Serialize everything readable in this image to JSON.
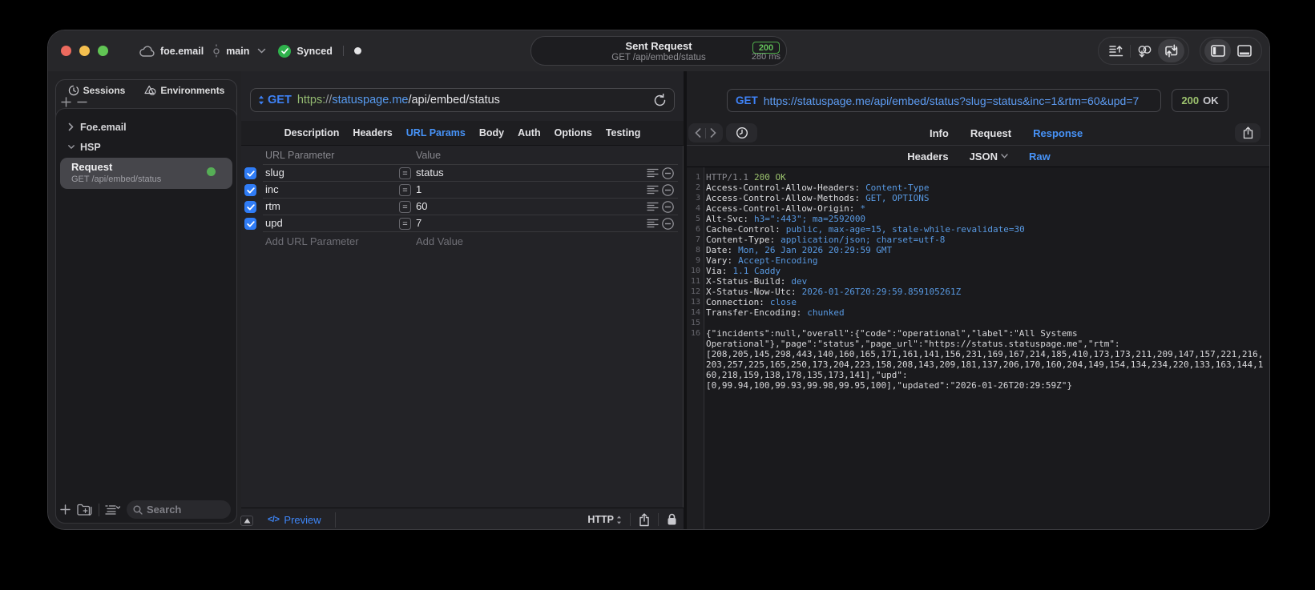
{
  "titlebar": {
    "project": "foe.email",
    "branch": "main",
    "sync_status": "Synced",
    "request_pill": {
      "title": "Sent Request",
      "subtitle": "GET /api/embed/status",
      "status_code": "200",
      "duration": "280 ms"
    }
  },
  "sidebar": {
    "tab_sessions": "Sessions",
    "tab_environments": "Environments",
    "group_collapsed": "Foe.email",
    "group_expanded": "HSP",
    "request_item": {
      "title": "Request",
      "subtitle": "GET /api/embed/status"
    },
    "search_placeholder": "Search"
  },
  "request_pane": {
    "method": "GET",
    "url_segments": {
      "scheme": "https:",
      "slashes": "//",
      "host": "statuspage.me",
      "path": "/api/embed/status"
    },
    "tabs": [
      "Description",
      "Headers",
      "URL Params",
      "Body",
      "Auth",
      "Options",
      "Testing"
    ],
    "active_tab": "URL Params",
    "param_table": {
      "col_param": "URL Parameter",
      "col_value": "Value",
      "rows": [
        {
          "name": "slug",
          "value": "status",
          "enabled": true
        },
        {
          "name": "inc",
          "value": "1",
          "enabled": true
        },
        {
          "name": "rtm",
          "value": "60",
          "enabled": true
        },
        {
          "name": "upd",
          "value": "7",
          "enabled": true
        }
      ],
      "add_param_placeholder": "Add URL Parameter",
      "add_value_placeholder": "Add Value"
    },
    "footer": {
      "code_glyph": "</>",
      "preview_label": "Preview",
      "protocol": "HTTP"
    }
  },
  "response_pane": {
    "method": "GET",
    "url": "https://statuspage.me/api/embed/status?slug=status&inc=1&rtm=60&upd=7",
    "status_code": "200",
    "status_text": "OK",
    "tabs": [
      "Info",
      "Request",
      "Response"
    ],
    "active_tab": "Response",
    "subtabs": [
      "Headers",
      "JSON",
      "Raw"
    ],
    "active_subtab": "Raw",
    "status_line": {
      "num": "1",
      "protocol": "HTTP/1.1",
      "status": "200 OK"
    },
    "headers": [
      {
        "num": "2",
        "key": "Access-Control-Allow-Headers:",
        "value": "Content-Type"
      },
      {
        "num": "3",
        "key": "Access-Control-Allow-Methods:",
        "value": "GET, OPTIONS"
      },
      {
        "num": "4",
        "key": "Access-Control-Allow-Origin:",
        "value": "*"
      },
      {
        "num": "5",
        "key": "Alt-Svc:",
        "value": "h3=\":443\"; ma=2592000"
      },
      {
        "num": "6",
        "key": "Cache-Control:",
        "value": "public, max-age=15, stale-while-revalidate=30"
      },
      {
        "num": "7",
        "key": "Content-Type:",
        "value": "application/json; charset=utf-8"
      },
      {
        "num": "8",
        "key": "Date:",
        "value": "Mon, 26 Jan 2026 20:29:59 GMT"
      },
      {
        "num": "9",
        "key": "Vary:",
        "value": "Accept-Encoding"
      },
      {
        "num": "10",
        "key": "Via:",
        "value": "1.1 Caddy"
      },
      {
        "num": "11",
        "key": "X-Status-Build:",
        "value": "dev"
      },
      {
        "num": "12",
        "key": "X-Status-Now-Utc:",
        "value": "2026-01-26T20:29:59.859105261Z"
      },
      {
        "num": "13",
        "key": "Connection:",
        "value": "close"
      },
      {
        "num": "14",
        "key": "Transfer-Encoding:",
        "value": "chunked"
      }
    ],
    "blank_line_num": "15",
    "body_lines": [
      {
        "num": "16",
        "text": "{\"incidents\":null,\"overall\":{\"code\":\"operational\",\"label\":\"All Systems"
      },
      {
        "num": "",
        "text": "Operational\"},\"page\":\"status\",\"page_url\":\"https://status.statuspage.me\",\"rtm\":"
      },
      {
        "num": "",
        "text": "[208,205,145,298,443,140,160,165,171,161,141,156,231,169,167,214,185,410,173,173,211,209,147,157,221,216,"
      },
      {
        "num": "",
        "text": "203,257,225,165,250,173,204,223,158,208,143,209,181,137,206,170,160,204,149,154,134,234,220,133,163,144,1"
      },
      {
        "num": "",
        "text": "60,218,159,138,178,135,173,141],\"upd\":"
      },
      {
        "num": "",
        "text": "[0,99.94,100,99.93,99.98,99.95,100],\"updated\":\"2026-01-26T20:29:59Z\"}"
      }
    ]
  }
}
